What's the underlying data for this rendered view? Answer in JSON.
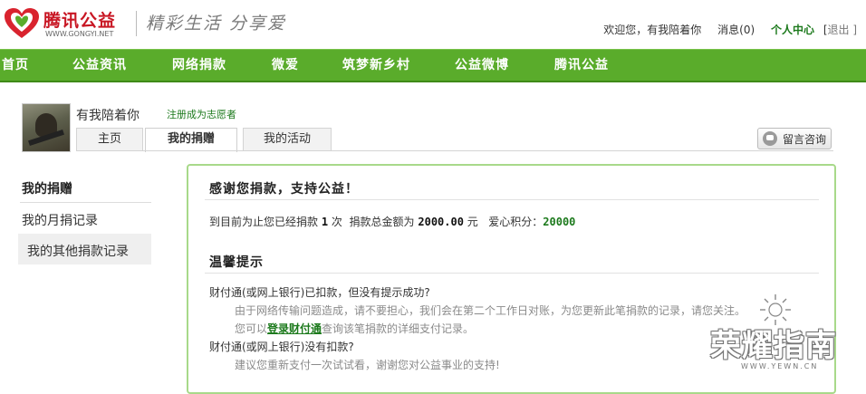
{
  "header": {
    "brand": "腾讯公益",
    "brand_url": "WWW.GONGYI.NET",
    "slogan": "精彩生活 分享爱",
    "welcome": "欢迎您，有我陪着你",
    "messages": "消息(0)",
    "personal_center": "个人中心",
    "bracket_open": "[",
    "logout": "退出 ]"
  },
  "nav": {
    "items": [
      "首页",
      "公益资讯",
      "网络捐款",
      "微爱",
      "筑梦新乡村",
      "公益微博",
      "腾讯公益"
    ]
  },
  "profile": {
    "username": "有我陪着你",
    "volunteer_link": "注册成为志愿者",
    "tabs": [
      "主页",
      "我的捐赠",
      "我的活动"
    ],
    "active_tab": "我的捐赠",
    "consult_button": "留言咨询"
  },
  "sidebar": {
    "title": "我的捐赠",
    "items": [
      "我的月捐记录",
      "我的其他捐款记录"
    ]
  },
  "main": {
    "thanks_title": "感谢您捐款，支持公益！",
    "stats_prefix": "到目前为止您已经捐款",
    "donation_count": "1",
    "count_suffix": "次  捐款总金额为",
    "total_amount": "2000.00",
    "amount_unit": "元",
    "points_label": "爱心积分：",
    "points": "20000",
    "tips_title": "温馨提示",
    "q1": "财付通(或网上银行)已扣款，但没有提示成功?",
    "a1_line1": "由于网络传输问题造成，请不要担心，我们会在第二个工作日对账，为您更新此笔捐款的记录，请您关注。",
    "a1_line2_prefix": "您可以",
    "a1_line2_link": "登录财付通",
    "a1_line2_suffix": "查询该笔捐款的详细支付记录。",
    "q2": "财付通(或网上银行)没有扣款?",
    "a2": "建议您重新支付一次试试看，谢谢您对公益事业的支持!"
  },
  "watermark": {
    "text": "荣耀指南",
    "url": "WWW.YEWN.CN"
  },
  "colors": {
    "nav_green": "#5aac2b",
    "brand_red": "#c81623",
    "panel_border": "#a8d98a",
    "link_green": "#1d7a1d"
  }
}
